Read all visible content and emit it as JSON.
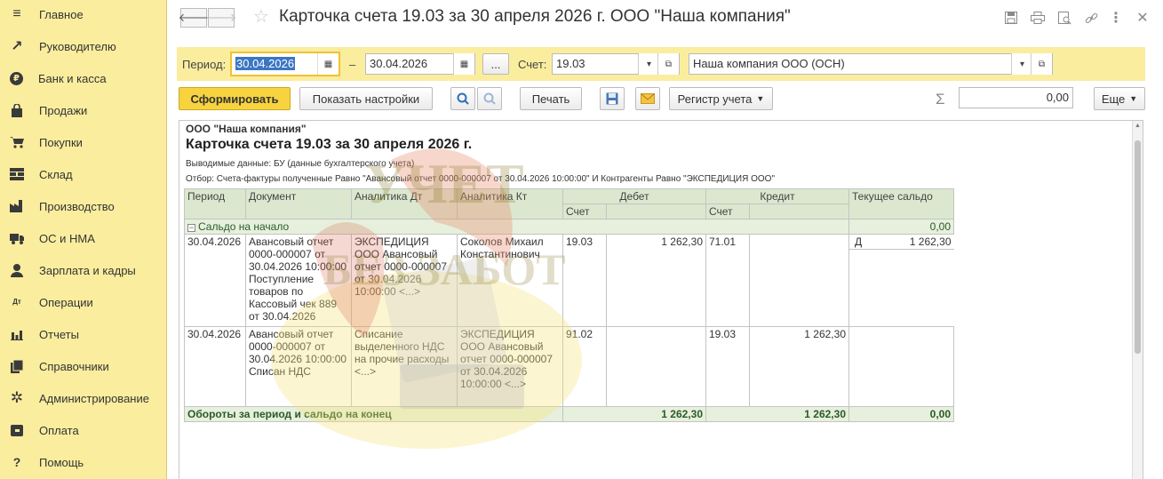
{
  "sidebar": {
    "items": [
      {
        "label": "Главное",
        "icon": "menu-icon",
        "glyph": "≡"
      },
      {
        "label": "Руководителю",
        "icon": "trend-icon",
        "glyph": "↗"
      },
      {
        "label": "Банк и касса",
        "icon": "ruble-icon",
        "glyph": "₽"
      },
      {
        "label": "Продажи",
        "icon": "bag-icon",
        "glyph": "▣"
      },
      {
        "label": "Покупки",
        "icon": "cart-icon",
        "glyph": "🛒"
      },
      {
        "label": "Склад",
        "icon": "warehouse-icon",
        "glyph": "▦"
      },
      {
        "label": "Производство",
        "icon": "factory-icon",
        "glyph": "▟"
      },
      {
        "label": "ОС и НМА",
        "icon": "truck-icon",
        "glyph": "▬"
      },
      {
        "label": "Зарплата и кадры",
        "icon": "person-icon",
        "glyph": "●"
      },
      {
        "label": "Операции",
        "icon": "dt-kt-icon",
        "glyph": "Дт"
      },
      {
        "label": "Отчеты",
        "icon": "bar-chart-icon",
        "glyph": "▮"
      },
      {
        "label": "Справочники",
        "icon": "books-icon",
        "glyph": "▤"
      },
      {
        "label": "Администрирование",
        "icon": "gear-icon",
        "glyph": "✲"
      },
      {
        "label": "Оплата",
        "icon": "wallet-icon",
        "glyph": "▣"
      },
      {
        "label": "Помощь",
        "icon": "help-icon",
        "glyph": "?"
      }
    ]
  },
  "header": {
    "title": "Карточка счета 19.03 за 30 апреля 2026 г. ООО \"Наша компания\"",
    "back_glyph": "🡐",
    "forward_glyph": "🡒",
    "star_glyph": "☆",
    "icons": [
      {
        "name": "save-icon",
        "glyph": "🖫"
      },
      {
        "name": "print-icon",
        "glyph": "⎙"
      },
      {
        "name": "preview-icon",
        "glyph": "⌕"
      },
      {
        "name": "link-icon",
        "glyph": "🔗"
      },
      {
        "name": "more-vertical-icon",
        "glyph": "⋮"
      },
      {
        "name": "close-icon",
        "glyph": "✕"
      }
    ]
  },
  "filters": {
    "period_label": "Период:",
    "date_from": "30.04.2026",
    "dash": "–",
    "date_to": "30.04.2026",
    "ellipsis": "...",
    "account_label": "Счет:",
    "account": "19.03",
    "organization": "Наша компания ООО (ОСН)"
  },
  "toolbar": {
    "generate": "Сформировать",
    "show_settings": "Показать настройки",
    "print": "Печать",
    "register": "Регистр учета",
    "sum_symbol": "Σ",
    "sum_value": "0,00",
    "more": "Еще"
  },
  "report": {
    "org": "ООО \"Наша компания\"",
    "title": "Карточка счета 19.03 за 30 апреля 2026 г.",
    "output_data": "Выводимые данные: БУ (данные бухгалтерского учета)",
    "filter_text": "Отбор: Счета-фактуры полученные Равно \"Авансовый отчет 0000-000007 от 30.04.2026 10:00:00\" И Контрагенты Равно \"ЭКСПЕДИЦИЯ ООО\"",
    "headers": {
      "period": "Период",
      "document": "Документ",
      "analytics_dt": "Аналитика Дт",
      "analytics_kt": "Аналитика Кт",
      "debit": "Дебет",
      "credit": "Кредит",
      "balance": "Текущее сальдо",
      "account": "Счет"
    },
    "opening": {
      "label": "Сальдо на начало",
      "value": "0,00"
    },
    "rows": [
      {
        "period": "30.04.2026",
        "document": "Авансовый отчет 0000-000007 от 30.04.2026 10:00:00 Поступление товаров по Кассовый чек 889 от 30.04.2026",
        "analytics_dt": "ЭКСПЕДИЦИЯ ООО Авансовый отчет 0000-000007 от 30.04.2026 10:00:00 <...>",
        "analytics_kt": "Соколов Михаил Константинович",
        "dt_account": "19.03",
        "dt_sum": "1 262,30",
        "kt_account": "71.01",
        "kt_sum": "",
        "bal_side": "Д",
        "bal_sum": "1 262,30"
      },
      {
        "period": "30.04.2026",
        "document": "Авансовый отчет 0000-000007 от 30.04.2026 10:00:00 Списан НДС",
        "analytics_dt": "Списание выделенного НДС на прочие расходы <...>",
        "analytics_kt": "ЭКСПЕДИЦИЯ ООО Авансовый отчет 0000-000007 от 30.04.2026 10:00:00 <...>",
        "dt_account": "91.02",
        "dt_sum": "",
        "kt_account": "19.03",
        "kt_sum": "1 262,30",
        "bal_side": "",
        "bal_sum": ""
      }
    ],
    "totals": {
      "label": "Обороты за период и сальдо на конец",
      "debit": "1 262,30",
      "credit": "1 262,30",
      "balance": "0,00"
    }
  },
  "watermark": {
    "line1": "УЧЕТ",
    "line2": "БЕЗ ЗАБОТ"
  }
}
